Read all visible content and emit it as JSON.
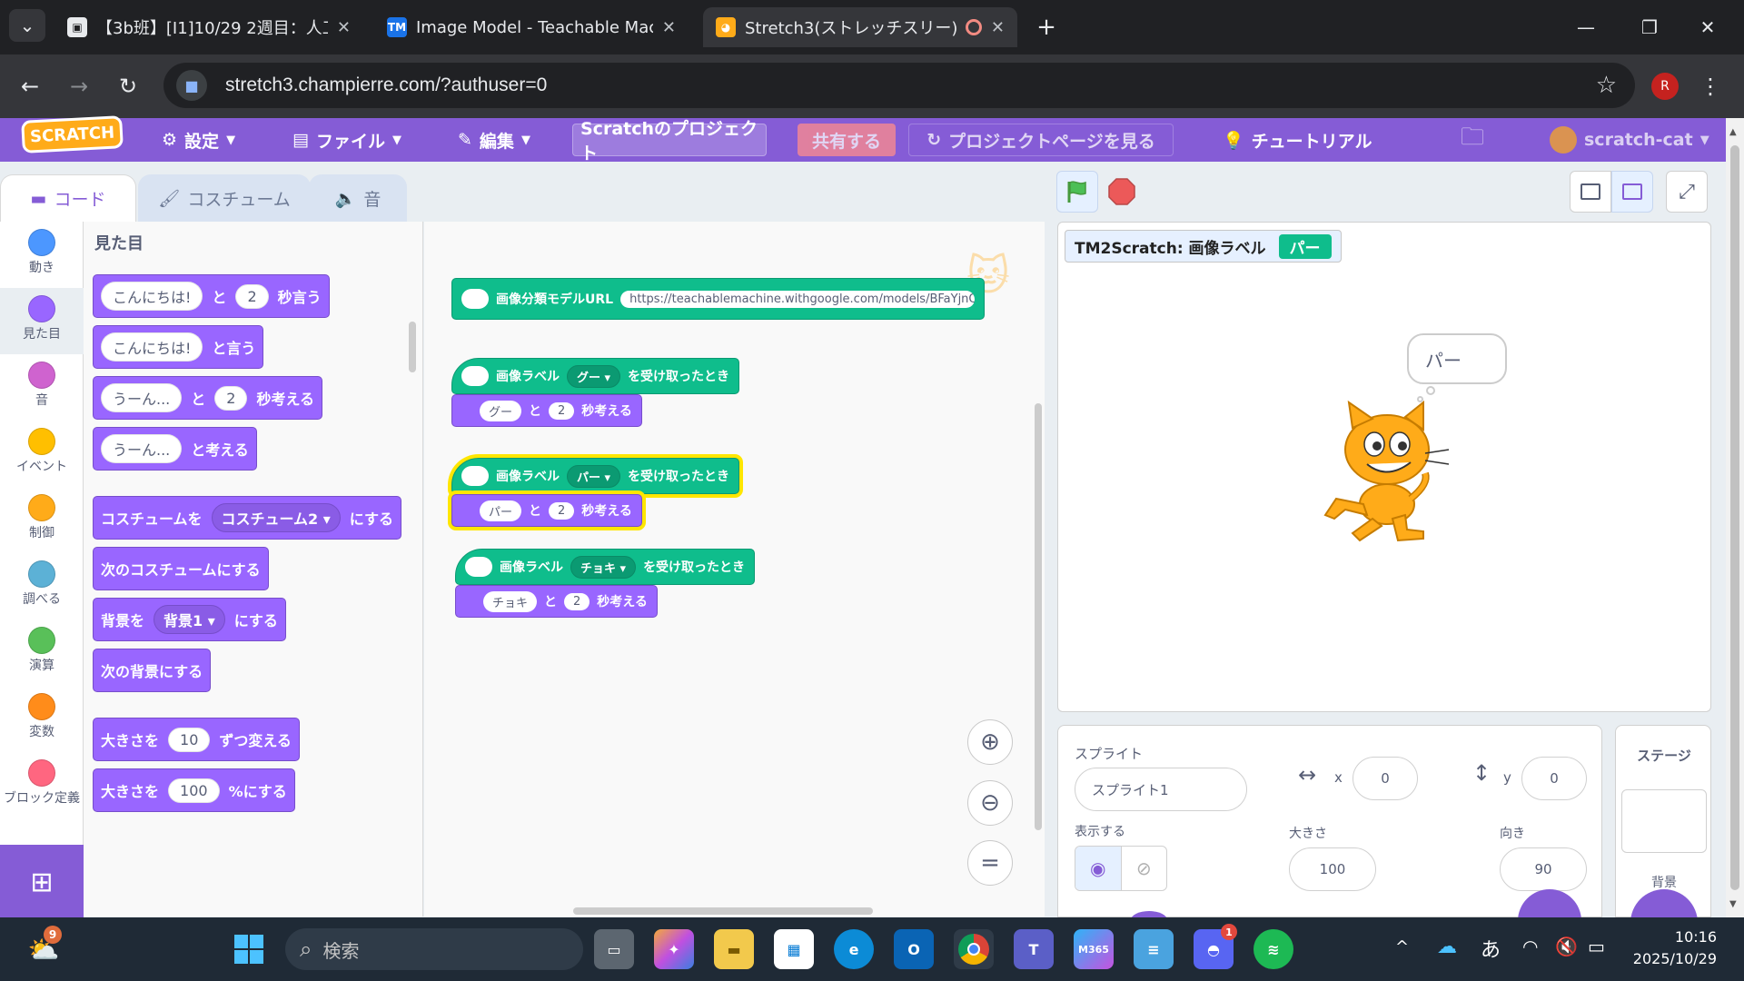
{
  "browser": {
    "tabs": [
      {
        "title": "【3b班】[I1]10/29 2週目：人工知",
        "active": false
      },
      {
        "title": "Image Model - Teachable Mach",
        "active": false
      },
      {
        "title": "Stretch3(ストレッチスリー)",
        "active": true
      }
    ],
    "url": "stretch3.champierre.com/?authuser=0",
    "profile_initial": "R"
  },
  "menubar": {
    "logo": "SCRATCH",
    "settings": "設定",
    "file": "ファイル",
    "edit": "編集",
    "project_title": "Scratchのプロジェクト",
    "share": "共有する",
    "see_project_page": "プロジェクトページを見る",
    "tutorials": "チュートリアル",
    "username": "scratch-cat"
  },
  "editor_tabs": {
    "code": "コード",
    "costumes": "コスチューム",
    "sounds": "音"
  },
  "categories": [
    {
      "label": "動き",
      "color": "#4c97ff"
    },
    {
      "label": "見た目",
      "color": "#9966ff"
    },
    {
      "label": "音",
      "color": "#cf63cf"
    },
    {
      "label": "イベント",
      "color": "#ffbf00"
    },
    {
      "label": "制御",
      "color": "#ffab19"
    },
    {
      "label": "調べる",
      "color": "#5cb1d6"
    },
    {
      "label": "演算",
      "color": "#59c059"
    },
    {
      "label": "変数",
      "color": "#ff8c1a"
    },
    {
      "label": "ブロック定義",
      "color": "#ff6680"
    }
  ],
  "palette": {
    "heading": "見た目",
    "blocks": [
      {
        "parts": [
          {
            "t": "pill",
            "v": "こんにちは!"
          },
          {
            "t": "text",
            "v": "と"
          },
          {
            "t": "pill",
            "v": "2"
          },
          {
            "t": "text",
            "v": "秒言う"
          }
        ]
      },
      {
        "parts": [
          {
            "t": "pill",
            "v": "こんにちは!"
          },
          {
            "t": "text",
            "v": "と言う"
          }
        ]
      },
      {
        "parts": [
          {
            "t": "pill",
            "v": "うーん..."
          },
          {
            "t": "text",
            "v": "と"
          },
          {
            "t": "pill",
            "v": "2"
          },
          {
            "t": "text",
            "v": "秒考える"
          }
        ]
      },
      {
        "parts": [
          {
            "t": "pill",
            "v": "うーん..."
          },
          {
            "t": "text",
            "v": "と考える"
          }
        ]
      },
      {
        "parts": [
          {
            "t": "text",
            "v": "コスチュームを"
          },
          {
            "t": "dd",
            "v": "コスチューム2 ▾"
          },
          {
            "t": "text",
            "v": "にする"
          }
        ]
      },
      {
        "parts": [
          {
            "t": "text",
            "v": "次のコスチュームにする"
          }
        ]
      },
      {
        "parts": [
          {
            "t": "text",
            "v": "背景を"
          },
          {
            "t": "dd",
            "v": "背景1 ▾"
          },
          {
            "t": "text",
            "v": "にする"
          }
        ]
      },
      {
        "parts": [
          {
            "t": "text",
            "v": "次の背景にする"
          }
        ]
      },
      {
        "parts": [
          {
            "t": "text",
            "v": "大きさを"
          },
          {
            "t": "pill",
            "v": "10"
          },
          {
            "t": "text",
            "v": "ずつ変える"
          }
        ]
      },
      {
        "parts": [
          {
            "t": "text",
            "v": "大きさを"
          },
          {
            "t": "pill",
            "v": "100"
          },
          {
            "t": "text",
            "v": "%にする"
          }
        ]
      }
    ]
  },
  "scripts": {
    "model_url_label": "画像分類モデルURL",
    "model_url_value": "https://teachablemachine.withgoogle.com/models/BFaYjnQO",
    "hat_label": "画像ラベル",
    "hat_suffix": "を受け取ったとき",
    "and_label": "と",
    "think_suffix": "秒考える",
    "groups": [
      {
        "label": "グー ▾",
        "say": "グー",
        "secs": "2"
      },
      {
        "label": "パー ▾",
        "say": "パー",
        "secs": "2"
      },
      {
        "label": "チョキ ▾",
        "say": "チョキ",
        "secs": "2"
      }
    ]
  },
  "stage": {
    "monitor_label": "TM2Scratch: 画像ラベル",
    "monitor_value": "パー",
    "thought": "パー"
  },
  "sprite_info": {
    "sprite_label": "スプライト",
    "sprite_name": "スプライト1",
    "x_label": "x",
    "x_value": "0",
    "y_label": "y",
    "y_value": "0",
    "show_label": "表示する",
    "size_label": "大きさ",
    "size_value": "100",
    "direction_label": "向き",
    "direction_value": "90"
  },
  "stage_panel": {
    "title": "ステージ",
    "backdrops_label": "背景"
  },
  "taskbar": {
    "search_placeholder": "検索",
    "ime": "あ",
    "time": "10:16",
    "date": "2025/10/29",
    "weather_badge": "9",
    "discord_badge": "1"
  }
}
